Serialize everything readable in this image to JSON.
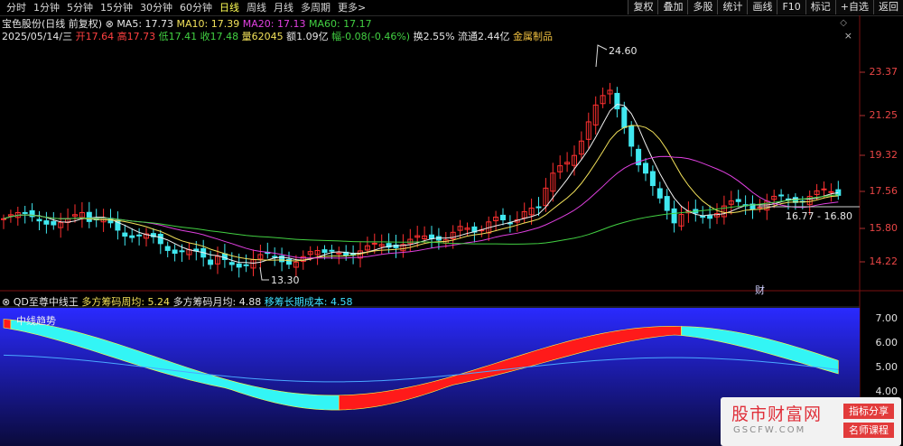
{
  "toolbar": {
    "tabs": [
      "分时",
      "1分钟",
      "5分钟",
      "15分钟",
      "30分钟",
      "60分钟",
      "日线",
      "周线",
      "月线",
      "多周期",
      "更多>"
    ],
    "active_tab": "日线",
    "right_buttons": [
      "复权",
      "叠加",
      "多股",
      "统计",
      "画线",
      "F10",
      "标记",
      "+自选",
      "返回"
    ]
  },
  "info": {
    "stock": "宝色股份(日线 前复权)",
    "ma5": "MA5: 17.73",
    "ma10": "MA10: 17.39",
    "ma20": "MA20: 17.13",
    "ma60": "MA60: 17.17",
    "date": "2025/05/14/三",
    "open": "开17.64",
    "high": "高17.73",
    "low": "低17.41",
    "close": "收17.48",
    "volume": "量62045",
    "amount": "额1.09亿",
    "change": "幅-0.08(-0.46%)",
    "turnover": "换2.55%",
    "float": "流通2.44亿",
    "industry": "金属制品"
  },
  "price_axis": [
    "23.37",
    "21.25",
    "19.32",
    "17.56",
    "15.80",
    "14.22"
  ],
  "annotations": {
    "high": "24.60",
    "low": "13.30",
    "range": "16.77 - 16.80",
    "cai": "财"
  },
  "indicator": {
    "name": "QD至尊中线王",
    "line1": "多方筹码周均: 5.24",
    "line2": "多方筹码月均: 4.88",
    "line3": "移筹长期成本: 4.58",
    "trend_label": "中线趋势",
    "axis": [
      "7.00",
      "6.00",
      "5.00",
      "4.00"
    ]
  },
  "watermark": {
    "main": "股市财富网",
    "url": "GSCFW.COM",
    "badge1": "指标分享",
    "badge2": "名师课程"
  },
  "colors": {
    "up": "#ff3030",
    "down": "#40e8f0",
    "ma5": "#f0f0f0",
    "ma10": "#f2e15a",
    "ma20": "#e040e0",
    "ma60": "#42d042"
  }
}
